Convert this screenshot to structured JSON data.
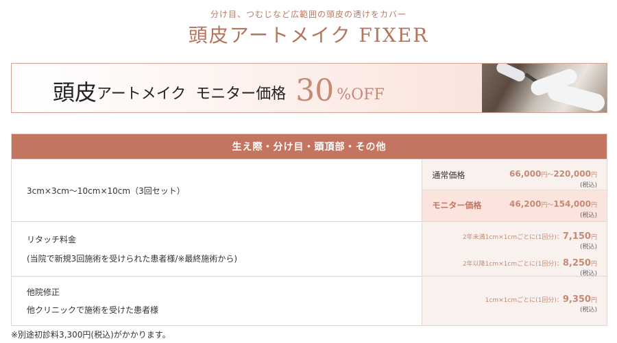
{
  "header": {
    "subtitle": "分け目、つむじなど広範囲の頭皮の透けをカバー",
    "title": "頭皮アートメイク FIXER"
  },
  "banner": {
    "text_big": "頭皮",
    "text_mid1": "アートメイク",
    "text_mid2": "モニター価格",
    "discount_number": "30",
    "discount_suffix": "%OFF",
    "photo_alt_icon": "gloved-hands-treatment-photo"
  },
  "table": {
    "heading": "生え際・分け目・頭頂部・その他",
    "rows": [
      {
        "left_lines": [
          "3cm×3cm〜10cm×10cm（3回セット）"
        ],
        "prices": [
          {
            "label": "通常価格",
            "value": "66,000",
            "sep": "円〜",
            "value2": "220,000",
            "unit": "円",
            "tax": "(税込)"
          },
          {
            "label": "モニター価格",
            "value": "46,200",
            "sep": "円〜",
            "value2": "154,000",
            "unit": "円",
            "tax": "(税込)"
          }
        ]
      },
      {
        "left_lines": [
          "リタッチ料金",
          "(当院で新規3回施術を受けられた患者様/※最終施術から)"
        ],
        "prices": [
          {
            "label": "2年未満1cm×1cmごとに(1回分)：",
            "value": "7,150",
            "unit": "円",
            "tax": "(税込)"
          },
          {
            "label": "2年以降1cm×1cmごとに(1回分)：",
            "value": "8,250",
            "unit": "円",
            "tax": "(税込)"
          }
        ]
      },
      {
        "left_lines": [
          "他院修正",
          "他クリニックで施術を受けた患者様"
        ],
        "prices": [
          {
            "label": "1cm×1cmごとに(1回分)：",
            "value": "9,350",
            "unit": "円",
            "tax": "(税込)"
          }
        ]
      }
    ]
  },
  "footnote": "※別途初診料3,300円(税込)がかかります。",
  "colors": {
    "accent": "#c4755f",
    "title": "#b5735c",
    "price": "#c48a74",
    "cell_bg": "#f9f1ee"
  }
}
